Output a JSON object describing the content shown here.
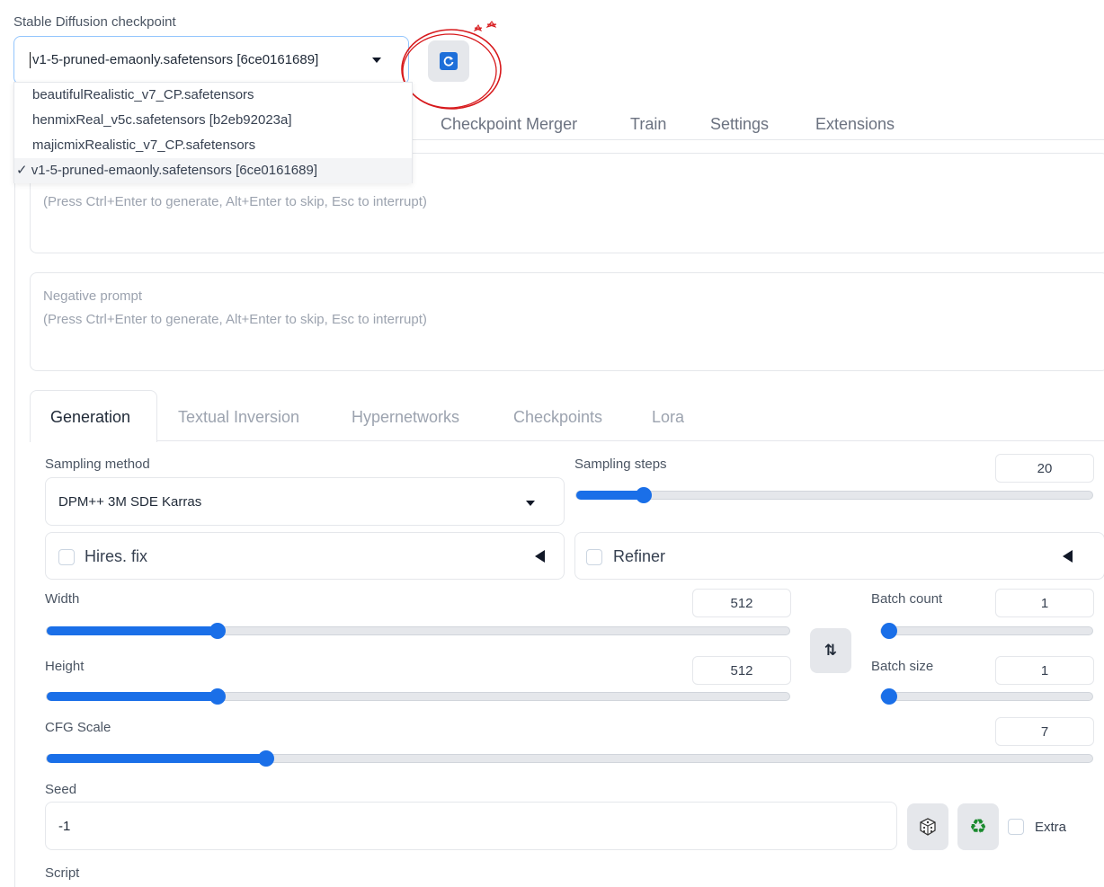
{
  "checkpoint": {
    "label": "Stable Diffusion checkpoint",
    "selected": "v1-5-pruned-emaonly.safetensors [6ce0161689]",
    "options": [
      "beautifulRealistic_v7_CP.safetensors",
      "henmixReal_v5c.safetensors [b2eb92023a]",
      "majicmixRealistic_v7_CP.safetensors",
      "✓ v1-5-pruned-emaonly.safetensors [6ce0161689]"
    ],
    "refresh_icon": "refresh-icon"
  },
  "top_tabs": [
    "Checkpoint Merger",
    "Train",
    "Settings",
    "Extensions"
  ],
  "prompt": {
    "placeholder": "(Press Ctrl+Enter to generate, Alt+Enter to skip, Esc to interrupt)"
  },
  "negative_prompt": {
    "label": "Negative prompt",
    "placeholder": "(Press Ctrl+Enter to generate, Alt+Enter to skip, Esc to interrupt)"
  },
  "gen_tabs": [
    "Generation",
    "Textual Inversion",
    "Hypernetworks",
    "Checkpoints",
    "Lora"
  ],
  "sampling_method": {
    "label": "Sampling method",
    "value": "DPM++ 3M SDE Karras"
  },
  "sampling_steps": {
    "label": "Sampling steps",
    "value": "20",
    "level": 0.13
  },
  "hires_fix": {
    "label": "Hires. fix"
  },
  "refiner": {
    "label": "Refiner"
  },
  "width": {
    "label": "Width",
    "value": "512",
    "level": 0.23
  },
  "height": {
    "label": "Height",
    "value": "512",
    "level": 0.23
  },
  "batch_count": {
    "label": "Batch count",
    "value": "1",
    "level": 0.0
  },
  "batch_size": {
    "label": "Batch size",
    "value": "1",
    "level": 0.0
  },
  "swap_icon": "swap-arrows-icon",
  "cfg_scale": {
    "label": "CFG Scale",
    "value": "7",
    "level": 0.21
  },
  "seed": {
    "label": "Seed",
    "value": "-1",
    "extra_label": "Extra"
  },
  "dice_icon": "dice-icon",
  "recycle_icon": "recycle-icon",
  "script": {
    "label": "Script"
  }
}
